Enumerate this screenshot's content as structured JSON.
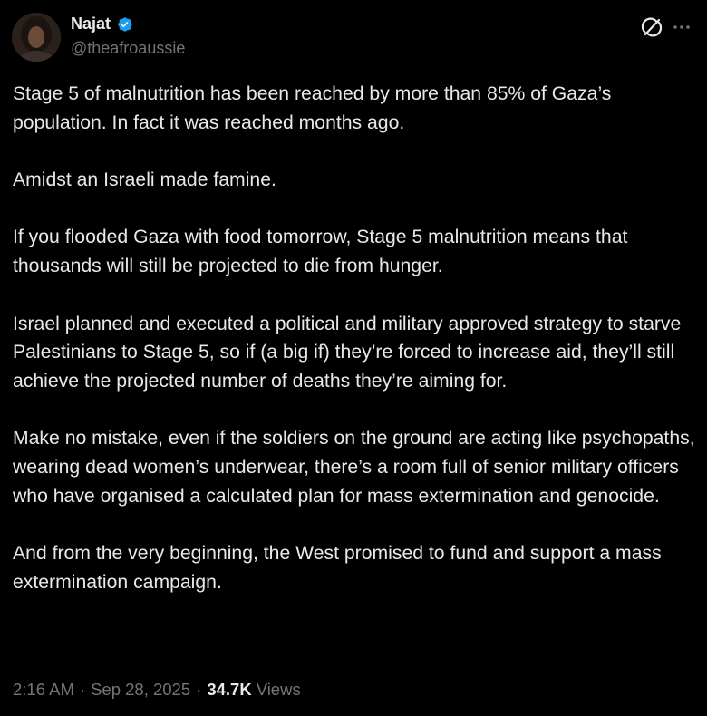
{
  "author": {
    "display_name": "Najat",
    "handle": "@theafroaussie",
    "verified": true
  },
  "icons": {
    "verified": "verified-badge-icon",
    "grok": "grok-icon",
    "more": "more-icon"
  },
  "colors": {
    "background": "#000000",
    "text": "#e7e9ea",
    "secondary": "#71767b",
    "verified": "#1d9bf0"
  },
  "tweet": {
    "paragraphs": [
      "Stage 5 of malnutrition has been reached by more than 85% of Gaza’s population. In fact it was reached months ago.",
      "Amidst an Israeli made famine.",
      "If you flooded Gaza with food tomorrow, Stage 5 malnutrition means that thousands will still be projected to die from hunger.",
      "Israel planned and executed a political and military approved strategy to starve Palestinians to Stage 5, so if (a big if) they’re forced to increase aid, they’ll still achieve the projected number of deaths they’re aiming for.",
      "Make no mistake, even if the soldiers on the ground are acting like psychopaths, wearing dead women’s underwear, there’s a room full of senior military officers who have organised a calculated plan for mass extermination and genocide.",
      "And from the very beginning, the West promised to fund and support a mass extermination campaign."
    ]
  },
  "meta": {
    "time": "2:16 AM",
    "separator": "·",
    "date": "Sep 28, 2025",
    "views_count": "34.7K",
    "views_label": "Views"
  }
}
